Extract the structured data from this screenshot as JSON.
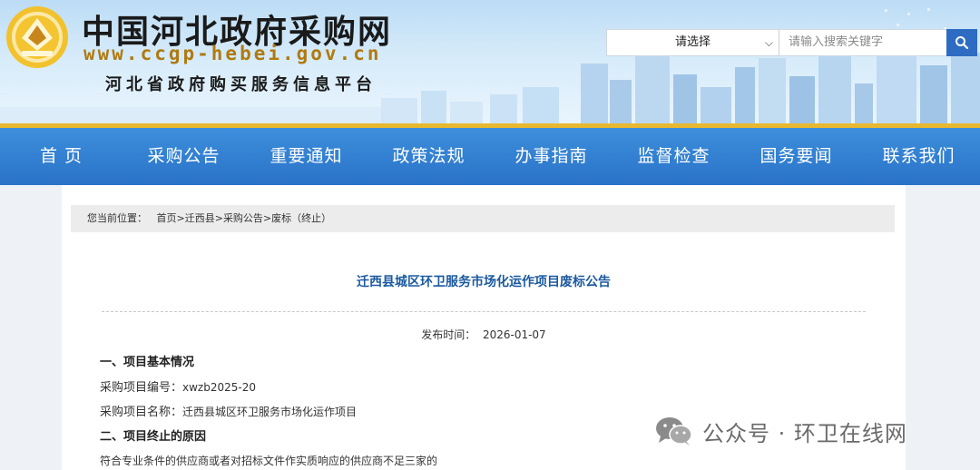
{
  "header": {
    "site_name": "中国河北政府采购网",
    "site_url": "www.ccgp-hebei.gov.cn",
    "subtitle": "河北省政府购买服务信息平台"
  },
  "search": {
    "select_value": "请选择",
    "placeholder": "请输入搜索关键字",
    "button_icon": "search-icon"
  },
  "nav": {
    "items": [
      "首 页",
      "采购公告",
      "重要通知",
      "政策法规",
      "办事指南",
      "监督检查",
      "国务要闻",
      "联系我们"
    ]
  },
  "breadcrumb": {
    "label": "您当前位置：",
    "home": "首页",
    "county": "迁西县",
    "category": "采购公告",
    "current": "废标（终止）",
    "separator": ">"
  },
  "article": {
    "title": "迁西县城区环卫服务市场化运作项目废标公告",
    "publish_label": "发布时间：",
    "publish_date": "2026-01-07",
    "section1_heading": "一、项目基本情况",
    "project_no_label": "采购项目编号：",
    "project_no": "xwzb2025-20",
    "project_name_label": "采购项目名称：",
    "project_name": "迁西县城区环卫服务市场化运作项目",
    "section2_heading": "二、项目终止的原因",
    "reason": "符合专业条件的供应商或者对招标文件作实质响应的供应商不足三家的"
  },
  "watermark": {
    "text": "公众号 · 环卫在线网"
  },
  "colors": {
    "nav_blue": "#2a72c8",
    "title_blue": "#1c5aa0",
    "gold": "#e8b830",
    "search_button": "#2d6cc2"
  }
}
